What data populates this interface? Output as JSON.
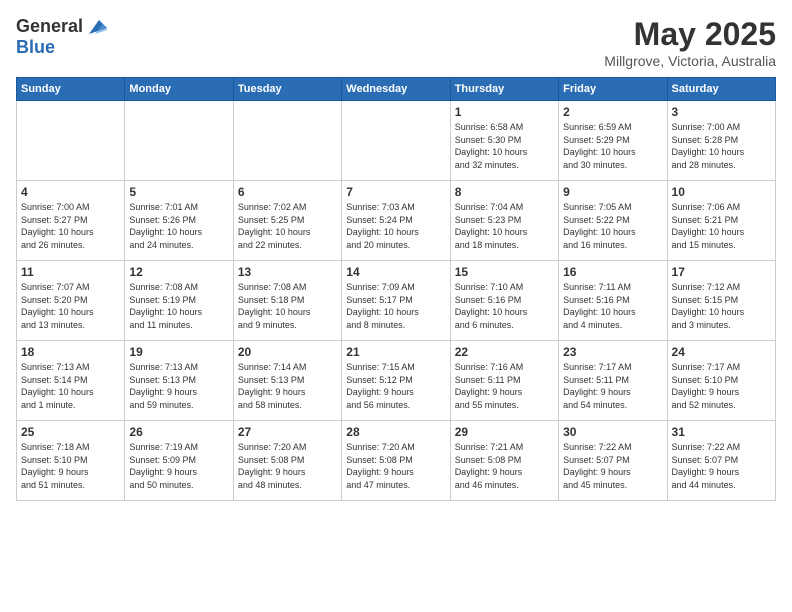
{
  "header": {
    "logo_general": "General",
    "logo_blue": "Blue",
    "month": "May 2025",
    "location": "Millgrove, Victoria, Australia"
  },
  "weekdays": [
    "Sunday",
    "Monday",
    "Tuesday",
    "Wednesday",
    "Thursday",
    "Friday",
    "Saturday"
  ],
  "weeks": [
    [
      {
        "day": "",
        "info": ""
      },
      {
        "day": "",
        "info": ""
      },
      {
        "day": "",
        "info": ""
      },
      {
        "day": "",
        "info": ""
      },
      {
        "day": "1",
        "info": "Sunrise: 6:58 AM\nSunset: 5:30 PM\nDaylight: 10 hours\nand 32 minutes."
      },
      {
        "day": "2",
        "info": "Sunrise: 6:59 AM\nSunset: 5:29 PM\nDaylight: 10 hours\nand 30 minutes."
      },
      {
        "day": "3",
        "info": "Sunrise: 7:00 AM\nSunset: 5:28 PM\nDaylight: 10 hours\nand 28 minutes."
      }
    ],
    [
      {
        "day": "4",
        "info": "Sunrise: 7:00 AM\nSunset: 5:27 PM\nDaylight: 10 hours\nand 26 minutes."
      },
      {
        "day": "5",
        "info": "Sunrise: 7:01 AM\nSunset: 5:26 PM\nDaylight: 10 hours\nand 24 minutes."
      },
      {
        "day": "6",
        "info": "Sunrise: 7:02 AM\nSunset: 5:25 PM\nDaylight: 10 hours\nand 22 minutes."
      },
      {
        "day": "7",
        "info": "Sunrise: 7:03 AM\nSunset: 5:24 PM\nDaylight: 10 hours\nand 20 minutes."
      },
      {
        "day": "8",
        "info": "Sunrise: 7:04 AM\nSunset: 5:23 PM\nDaylight: 10 hours\nand 18 minutes."
      },
      {
        "day": "9",
        "info": "Sunrise: 7:05 AM\nSunset: 5:22 PM\nDaylight: 10 hours\nand 16 minutes."
      },
      {
        "day": "10",
        "info": "Sunrise: 7:06 AM\nSunset: 5:21 PM\nDaylight: 10 hours\nand 15 minutes."
      }
    ],
    [
      {
        "day": "11",
        "info": "Sunrise: 7:07 AM\nSunset: 5:20 PM\nDaylight: 10 hours\nand 13 minutes."
      },
      {
        "day": "12",
        "info": "Sunrise: 7:08 AM\nSunset: 5:19 PM\nDaylight: 10 hours\nand 11 minutes."
      },
      {
        "day": "13",
        "info": "Sunrise: 7:08 AM\nSunset: 5:18 PM\nDaylight: 10 hours\nand 9 minutes."
      },
      {
        "day": "14",
        "info": "Sunrise: 7:09 AM\nSunset: 5:17 PM\nDaylight: 10 hours\nand 8 minutes."
      },
      {
        "day": "15",
        "info": "Sunrise: 7:10 AM\nSunset: 5:16 PM\nDaylight: 10 hours\nand 6 minutes."
      },
      {
        "day": "16",
        "info": "Sunrise: 7:11 AM\nSunset: 5:16 PM\nDaylight: 10 hours\nand 4 minutes."
      },
      {
        "day": "17",
        "info": "Sunrise: 7:12 AM\nSunset: 5:15 PM\nDaylight: 10 hours\nand 3 minutes."
      }
    ],
    [
      {
        "day": "18",
        "info": "Sunrise: 7:13 AM\nSunset: 5:14 PM\nDaylight: 10 hours\nand 1 minute."
      },
      {
        "day": "19",
        "info": "Sunrise: 7:13 AM\nSunset: 5:13 PM\nDaylight: 9 hours\nand 59 minutes."
      },
      {
        "day": "20",
        "info": "Sunrise: 7:14 AM\nSunset: 5:13 PM\nDaylight: 9 hours\nand 58 minutes."
      },
      {
        "day": "21",
        "info": "Sunrise: 7:15 AM\nSunset: 5:12 PM\nDaylight: 9 hours\nand 56 minutes."
      },
      {
        "day": "22",
        "info": "Sunrise: 7:16 AM\nSunset: 5:11 PM\nDaylight: 9 hours\nand 55 minutes."
      },
      {
        "day": "23",
        "info": "Sunrise: 7:17 AM\nSunset: 5:11 PM\nDaylight: 9 hours\nand 54 minutes."
      },
      {
        "day": "24",
        "info": "Sunrise: 7:17 AM\nSunset: 5:10 PM\nDaylight: 9 hours\nand 52 minutes."
      }
    ],
    [
      {
        "day": "25",
        "info": "Sunrise: 7:18 AM\nSunset: 5:10 PM\nDaylight: 9 hours\nand 51 minutes."
      },
      {
        "day": "26",
        "info": "Sunrise: 7:19 AM\nSunset: 5:09 PM\nDaylight: 9 hours\nand 50 minutes."
      },
      {
        "day": "27",
        "info": "Sunrise: 7:20 AM\nSunset: 5:08 PM\nDaylight: 9 hours\nand 48 minutes."
      },
      {
        "day": "28",
        "info": "Sunrise: 7:20 AM\nSunset: 5:08 PM\nDaylight: 9 hours\nand 47 minutes."
      },
      {
        "day": "29",
        "info": "Sunrise: 7:21 AM\nSunset: 5:08 PM\nDaylight: 9 hours\nand 46 minutes."
      },
      {
        "day": "30",
        "info": "Sunrise: 7:22 AM\nSunset: 5:07 PM\nDaylight: 9 hours\nand 45 minutes."
      },
      {
        "day": "31",
        "info": "Sunrise: 7:22 AM\nSunset: 5:07 PM\nDaylight: 9 hours\nand 44 minutes."
      }
    ]
  ]
}
